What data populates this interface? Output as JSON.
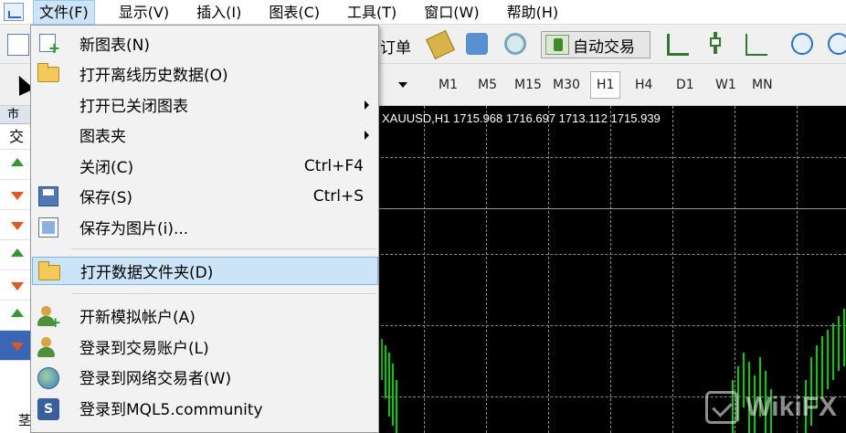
{
  "menubar": {
    "items": [
      "文件(F)",
      "显示(V)",
      "插入(I)",
      "图表(C)",
      "工具(T)",
      "窗口(W)",
      "帮助(H)"
    ]
  },
  "toolbar": {
    "order_label": "订单",
    "auto_trading_label": "自动交易",
    "timeframes": [
      "M1",
      "M5",
      "M15",
      "M30",
      "H1",
      "H4",
      "D1",
      "W1",
      "MN"
    ],
    "active_timeframe": "H1"
  },
  "left_panel": {
    "header": "市",
    "column": "交",
    "rows": [
      {
        "dir": "up"
      },
      {
        "dir": "down"
      },
      {
        "dir": "down"
      },
      {
        "dir": "up"
      },
      {
        "dir": "down"
      },
      {
        "dir": "up"
      },
      {
        "dir": "down",
        "selected": true
      }
    ],
    "bottom_char": "茎"
  },
  "chart": {
    "title": "XAUUSD,H1  1715.968 1716.697 1713.112 1715.939"
  },
  "file_menu": {
    "items": [
      {
        "label": "新图表(N)",
        "shortcut": "",
        "icon": "new-chart-icon"
      },
      {
        "label": "打开离线历史数据(O)",
        "shortcut": "",
        "icon": "folder-open-icon"
      },
      {
        "label": "打开已关闭图表",
        "shortcut": "",
        "icon": "",
        "submenu": true
      },
      {
        "label": "图表夹",
        "shortcut": "",
        "icon": "",
        "submenu": true
      },
      {
        "label": "关闭(C)",
        "shortcut": "Ctrl+F4",
        "icon": ""
      },
      {
        "label": "保存(S)",
        "shortcut": "Ctrl+S",
        "icon": "floppy-disk-icon"
      },
      {
        "label": "保存为图片(i)...",
        "shortcut": "",
        "icon": "save-image-icon"
      },
      {
        "label": "打开数据文件夹(D)",
        "shortcut": "",
        "icon": "folder-icon",
        "highlighted": true
      },
      {
        "label": "开新模拟帐户(A)",
        "shortcut": "",
        "icon": "add-user-icon"
      },
      {
        "label": "登录到交易账户(L)",
        "shortcut": "",
        "icon": "user-login-icon"
      },
      {
        "label": "登录到网络交易者(W)",
        "shortcut": "",
        "icon": "globe-icon"
      },
      {
        "label": "登录到MQL5.community",
        "shortcut": "",
        "icon": "mql5-icon"
      }
    ]
  },
  "watermark": "WikiFX"
}
